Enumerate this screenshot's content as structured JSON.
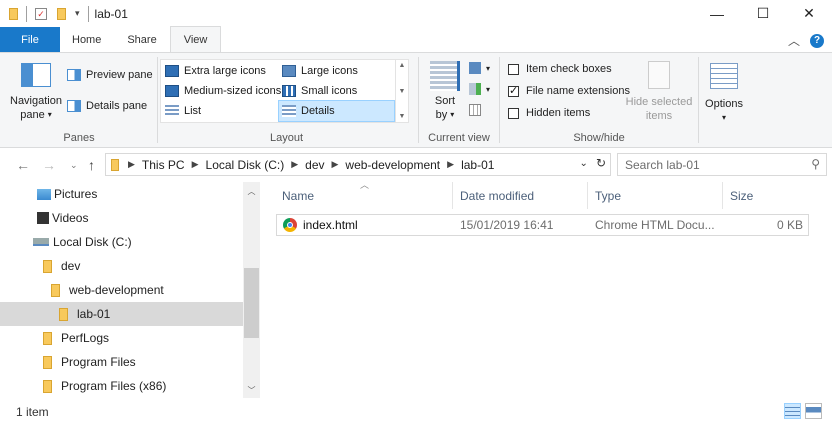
{
  "window": {
    "title": "lab-01",
    "minimize": "—",
    "maximize": "☐",
    "close": "✕"
  },
  "tabs": [
    {
      "label": "File"
    },
    {
      "label": "Home"
    },
    {
      "label": "Share"
    },
    {
      "label": "View"
    }
  ],
  "ribbon": {
    "panes": {
      "label": "Panes",
      "navigation_pane_line1": "Navigation",
      "navigation_pane_line2": "pane",
      "preview_pane": "Preview pane",
      "details_pane": "Details pane"
    },
    "layout": {
      "label": "Layout",
      "extra_large_icons": "Extra large icons",
      "large_icons": "Large icons",
      "medium_icons": "Medium-sized icons",
      "small_icons": "Small icons",
      "list": "List",
      "details": "Details"
    },
    "current_view": {
      "label": "Current view",
      "sort_line1": "Sort",
      "sort_line2": "by"
    },
    "show_hide": {
      "label": "Show/hide",
      "item_check_boxes": "Item check boxes",
      "file_name_extensions": "File name extensions",
      "hidden_items": "Hidden items",
      "hide_selected_line1": "Hide selected",
      "hide_selected_line2": "items"
    },
    "options": {
      "label": "Options"
    }
  },
  "address": {
    "crumbs": [
      "This PC",
      "Local Disk (C:)",
      "dev",
      "web-development",
      "lab-01"
    ],
    "search_placeholder": "Search lab-01"
  },
  "nav_pane": {
    "items": [
      {
        "label": "Pictures"
      },
      {
        "label": "Videos"
      },
      {
        "label": "Local Disk (C:)"
      },
      {
        "label": "dev"
      },
      {
        "label": "web-development"
      },
      {
        "label": "lab-01"
      },
      {
        "label": "PerfLogs"
      },
      {
        "label": "Program Files"
      },
      {
        "label": "Program Files (x86)"
      }
    ]
  },
  "columns": {
    "name": "Name",
    "date_modified": "Date modified",
    "type": "Type",
    "size": "Size"
  },
  "files": [
    {
      "name": "index.html",
      "date_modified": "15/01/2019 16:41",
      "type": "Chrome HTML Docu...",
      "size": "0 KB"
    }
  ],
  "status": {
    "item_count": "1 item"
  },
  "colors": {
    "accent": "#1979ca",
    "selection": "#cce8ff",
    "folder": "#f8c95c"
  }
}
